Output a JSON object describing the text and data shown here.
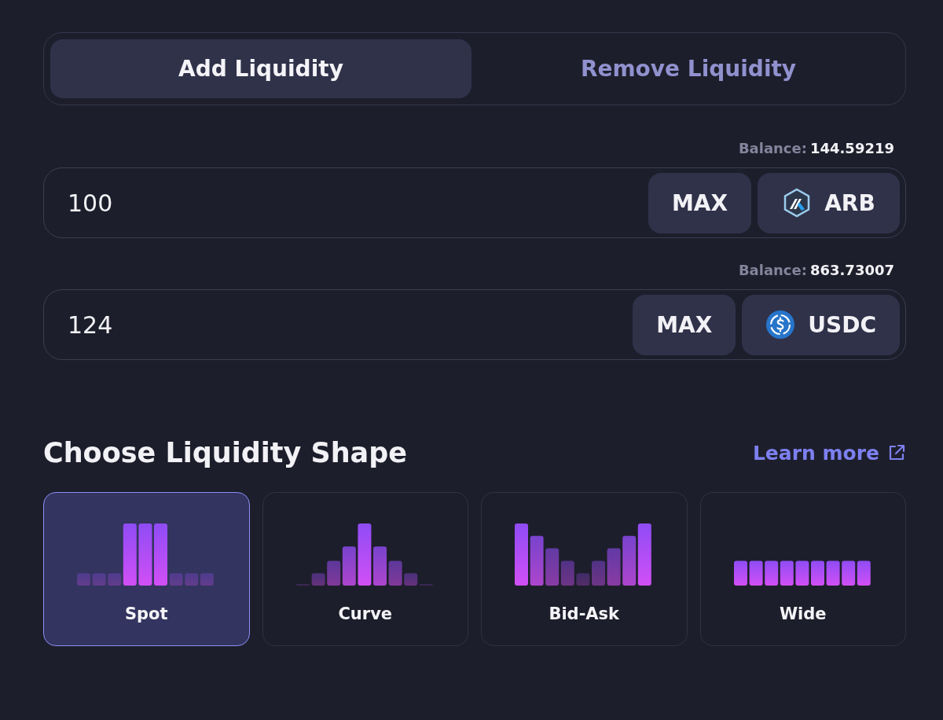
{
  "tabs": [
    {
      "label": "Add Liquidity",
      "selected": true
    },
    {
      "label": "Remove Liquidity",
      "selected": false
    }
  ],
  "inputs": [
    {
      "balance_label": "Balance:",
      "balance": "144.59219",
      "value": "100",
      "max": "MAX",
      "token": "ARB",
      "kind": "arb"
    },
    {
      "balance_label": "Balance:",
      "balance": "863.73007",
      "value": "124",
      "max": "MAX",
      "token": "USDC",
      "kind": "usdc"
    }
  ],
  "shape_section": {
    "title": "Choose Liquidity Shape",
    "link": "Learn more"
  },
  "shapes": [
    {
      "label": "Spot",
      "kind": "spot",
      "selected": true
    },
    {
      "label": "Curve",
      "kind": "curve",
      "selected": false
    },
    {
      "label": "Bid-Ask",
      "kind": "bid-ask",
      "selected": false
    },
    {
      "label": "Wide",
      "kind": "wide",
      "selected": false
    }
  ]
}
